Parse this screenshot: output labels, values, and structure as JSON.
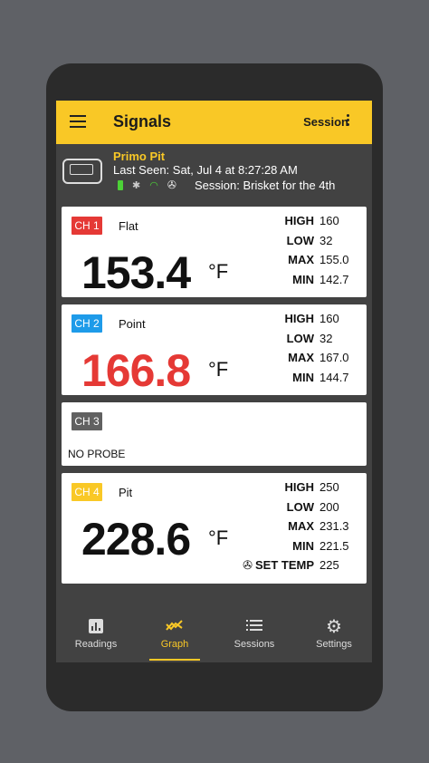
{
  "appbar": {
    "title": "Signals",
    "session_label": "Session"
  },
  "device": {
    "name": "Primo Pit",
    "last_seen": "Last Seen: Sat, Jul 4 at 8:27:28 AM",
    "session": "Session: Brisket for the 4th"
  },
  "channels": [
    {
      "badge": "CH 1",
      "badge_color": "#e53935",
      "name": "Flat",
      "temp": "153.4",
      "temp_color": "#000000",
      "unit": "°F",
      "stats": [
        {
          "label": "HIGH",
          "value": "160"
        },
        {
          "label": "LOW",
          "value": "32"
        },
        {
          "label": "MAX",
          "value": "155.0"
        },
        {
          "label": "MIN",
          "value": "142.7"
        }
      ]
    },
    {
      "badge": "CH 2",
      "badge_color": "#1e9be9",
      "name": "Point",
      "temp": "166.8",
      "temp_color": "#e53935",
      "unit": "°F",
      "stats": [
        {
          "label": "HIGH",
          "value": "160"
        },
        {
          "label": "LOW",
          "value": "32"
        },
        {
          "label": "MAX",
          "value": "167.0"
        },
        {
          "label": "MIN",
          "value": "144.7"
        }
      ]
    },
    {
      "badge": "CH 3",
      "badge_color": "#616161",
      "status": "NO PROBE"
    },
    {
      "badge": "CH 4",
      "badge_color": "#f9c826",
      "name": "Pit",
      "temp": "228.6",
      "temp_color": "#000000",
      "unit": "°F",
      "stats": [
        {
          "label": "HIGH",
          "value": "250"
        },
        {
          "label": "LOW",
          "value": "200"
        },
        {
          "label": "MAX",
          "value": "231.3"
        },
        {
          "label": "MIN",
          "value": "221.5"
        }
      ],
      "set_temp": {
        "label": "SET TEMP",
        "value": "225"
      }
    }
  ],
  "nav": [
    {
      "label": "Readings",
      "icon": "bar-chart-icon"
    },
    {
      "label": "Graph",
      "icon": "trending-icon"
    },
    {
      "label": "Sessions",
      "icon": "list-icon"
    },
    {
      "label": "Settings",
      "icon": "gear-icon"
    }
  ],
  "colors": {
    "accent": "#f9c826",
    "surface": "#424242",
    "card": "#ffffff"
  }
}
